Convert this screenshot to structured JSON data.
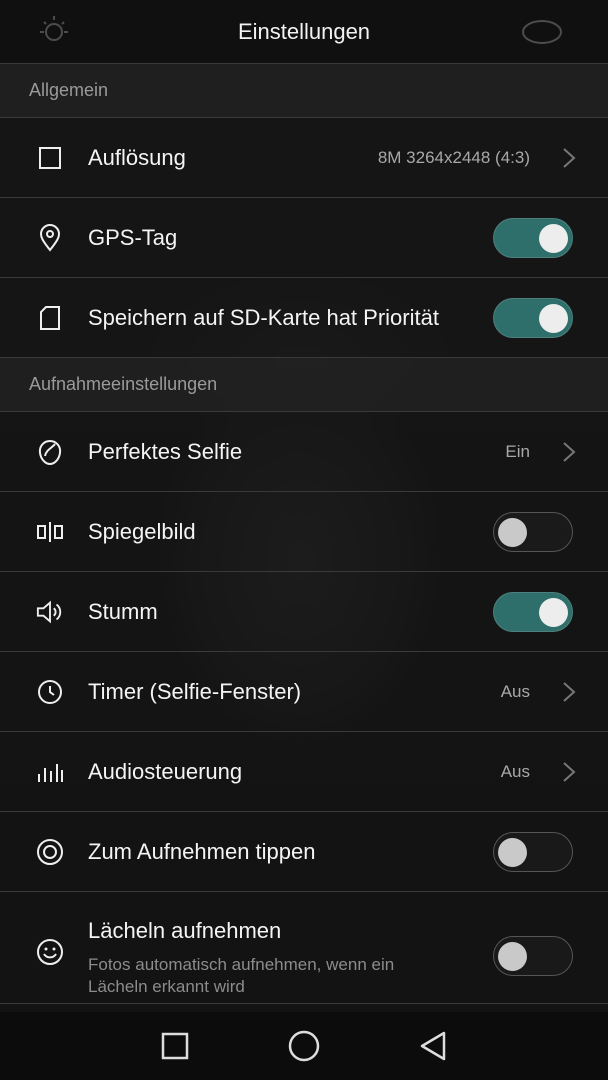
{
  "header": {
    "title": "Einstellungen"
  },
  "sections": {
    "general": "Allgemein",
    "capture": "Aufnahmeeinstellungen"
  },
  "items": [
    {
      "label": "Auflösung",
      "value": "8M 3264x2448 (4:3)",
      "icon": "square-frame-icon"
    },
    {
      "label": "GPS-Tag",
      "toggle": true,
      "icon": "location-pin-icon"
    },
    {
      "label": "Speichern auf SD-Karte hat Priorität",
      "toggle": true,
      "icon": "sd-card-icon"
    },
    {
      "label": "Perfektes Selfie",
      "value": "Ein",
      "icon": "selfie-face-icon"
    },
    {
      "label": "Spiegelbild",
      "toggle": false,
      "icon": "mirror-icon"
    },
    {
      "label": "Stumm",
      "toggle": true,
      "icon": "speaker-icon"
    },
    {
      "label": "Timer (Selfie-Fenster)",
      "value": "Aus",
      "icon": "clock-icon"
    },
    {
      "label": "Audiosteuerung",
      "value": "Aus",
      "icon": "audio-bars-icon"
    },
    {
      "label": "Zum Aufnehmen tippen",
      "toggle": false,
      "icon": "tap-capture-icon"
    },
    {
      "label": "Lächeln aufnehmen",
      "sublabel": "Fotos automatisch aufnehmen, wenn ein Lächeln erkannt wird",
      "toggle": false,
      "icon": "smile-icon"
    }
  ],
  "colors": {
    "toggle_on": "#2e6f6c",
    "knob": "#ededed",
    "divider": "#3a3a3a"
  }
}
